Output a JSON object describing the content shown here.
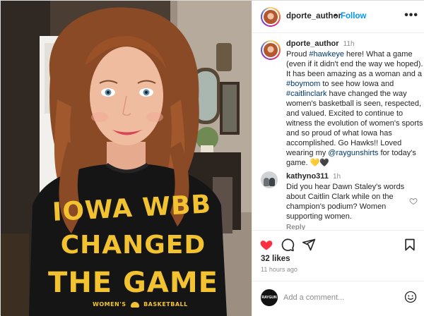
{
  "post": {
    "username": "dporte_author",
    "follow_label": "Follow",
    "more_label": "•••",
    "separator": "•"
  },
  "caption": {
    "username": "dporte_author",
    "time": "11h",
    "segments": [
      {
        "text": "Proud ",
        "tag": false
      },
      {
        "text": "#hawkeye",
        "tag": true
      },
      {
        "text": " here! What a game (even if it didn't end the way we hoped). It has been amazing as a woman and a ",
        "tag": false
      },
      {
        "text": "#boymom",
        "tag": true
      },
      {
        "text": " to see how Iowa and ",
        "tag": false
      },
      {
        "text": "#caitlinclark",
        "tag": true
      },
      {
        "text": " have changed the way women's basketball is seen, respected, and valued. Excited to continue to witness the evolution of women's sports and so proud of what Iowa has accomplished. Go Hawks!! Loved wearing my ",
        "tag": false
      },
      {
        "text": "@raygunshirts",
        "tag": true
      },
      {
        "text": " for today's game. 💛🖤",
        "tag": false
      }
    ]
  },
  "comment": {
    "username": "kathyno311",
    "time": "1h",
    "text": "Did you hear Dawn Staley's words about Caitlin Clark while on the champion's podium? Women supporting women.",
    "reply_label": "Reply"
  },
  "stats": {
    "likes": "32 likes",
    "time_ago": "11 hours ago"
  },
  "add_comment": {
    "placeholder": "Add a comment...",
    "avatar_text": "RAYGUN"
  },
  "shirt": {
    "line1": "IOWA WBB",
    "line2": "CHANGED",
    "line3": "THE GAME",
    "footer_left": "WOMEN'S",
    "footer_right": "BASKETBALL"
  },
  "colors": {
    "link": "#0095f6",
    "tag": "#00376b",
    "like_red": "#ff3040",
    "shirt_gold": "#f2c230"
  },
  "icons": [
    "heart-icon",
    "comment-icon",
    "share-icon",
    "bookmark-icon",
    "emoji-icon",
    "more-icon"
  ]
}
